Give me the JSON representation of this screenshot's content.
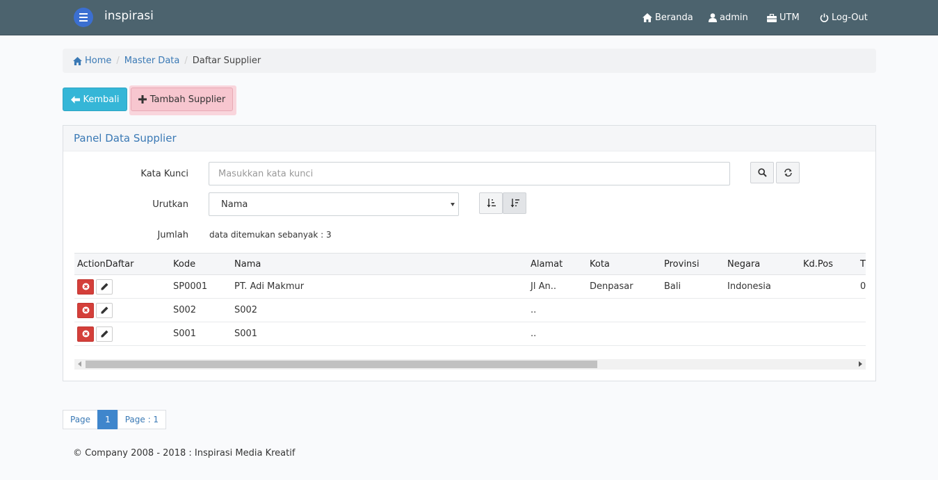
{
  "navbar": {
    "brand": "inspirasi",
    "links": {
      "beranda": "Beranda",
      "admin": "admin",
      "utm": "UTM",
      "logout": "Log-Out"
    }
  },
  "breadcrumb": {
    "home": "Home",
    "master": "Master Data",
    "current": "Daftar Supplier"
  },
  "buttons": {
    "kembali": "Kembali",
    "tambah": "Tambah Supplier"
  },
  "panel": {
    "title": "Panel Data Supplier",
    "kata_kunci_label": "Kata Kunci",
    "kata_kunci_placeholder": "Masukkan kata kunci",
    "urutkan_label": "Urutkan",
    "urutkan_value": "Nama",
    "jumlah_label": "Jumlah",
    "jumlah_text": "data ditemukan sebanyak : 3"
  },
  "table": {
    "columns": [
      "ActionDaftar",
      "Kode",
      "Nama",
      "Alamat",
      "Kota",
      "Provinsi",
      "Negara",
      "Kd.Pos",
      "T"
    ],
    "rows": [
      [
        "",
        "SP0001",
        "PT. Adi Makmur",
        "Jl An..",
        "Denpasar",
        "Bali",
        "Indonesia",
        "",
        "0"
      ],
      [
        "",
        "S002",
        "S002",
        "..",
        "",
        "",
        "",
        "",
        ""
      ],
      [
        "",
        "S001",
        "S001",
        "..",
        "",
        "",
        "",
        "",
        ""
      ]
    ]
  },
  "pagination": {
    "page_label": "Page",
    "current": "1",
    "summary": "Page : 1"
  },
  "footer": "© Company 2008 - 2018 : Inspirasi Media Kreatif",
  "colors": {
    "navbar": "#4c636e",
    "accent": "#3a79b5",
    "kembali": "#35b6d7",
    "tambah": "#f7c6cf",
    "delete": "#d43f3a"
  }
}
